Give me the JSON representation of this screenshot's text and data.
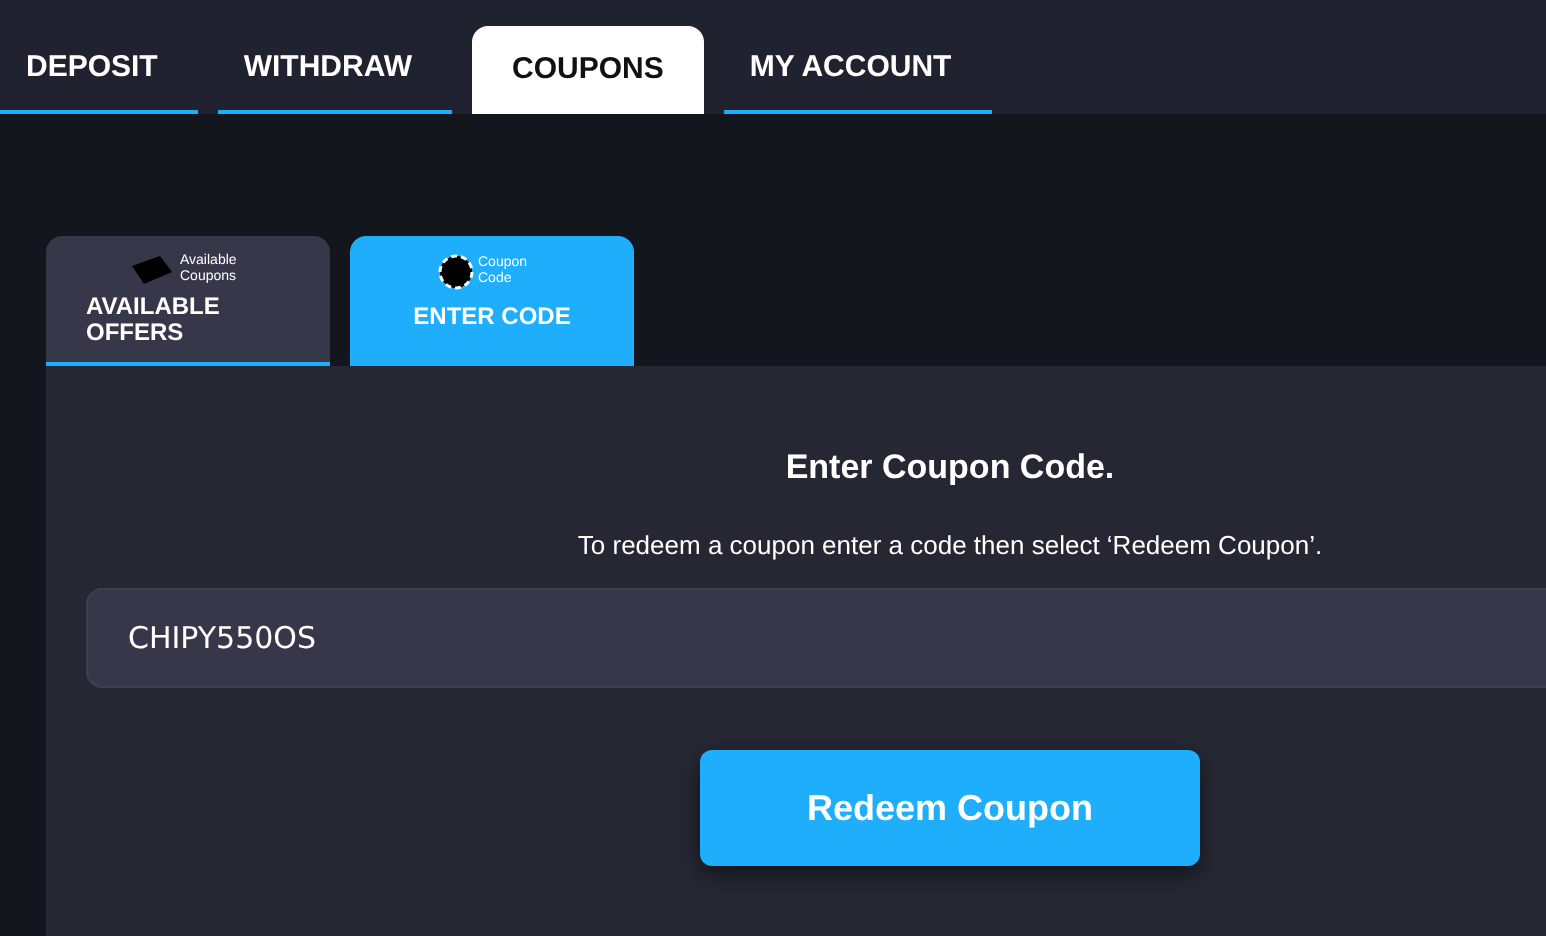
{
  "nav_tabs": [
    {
      "label": "DEPOSIT",
      "selected": false
    },
    {
      "label": "WITHDRAW",
      "selected": false
    },
    {
      "label": "COUPONS",
      "selected": true
    },
    {
      "label": "MY ACCOUNT",
      "selected": false
    }
  ],
  "coupon_tabs": [
    {
      "kind": "tag",
      "icon_caption": "Available Coupons",
      "label": "AVAILABLE OFFERS",
      "selected": false
    },
    {
      "kind": "code",
      "icon_caption": "Coupon Code",
      "label": "ENTER CODE",
      "selected": true
    }
  ],
  "panel": {
    "title": "Enter Coupon Code.",
    "instructions": "To redeem a coupon enter a code then select ‘Redeem Coupon’.",
    "code_field": {
      "value": "CHIPY550OS"
    },
    "button": "Redeem Coupon"
  }
}
